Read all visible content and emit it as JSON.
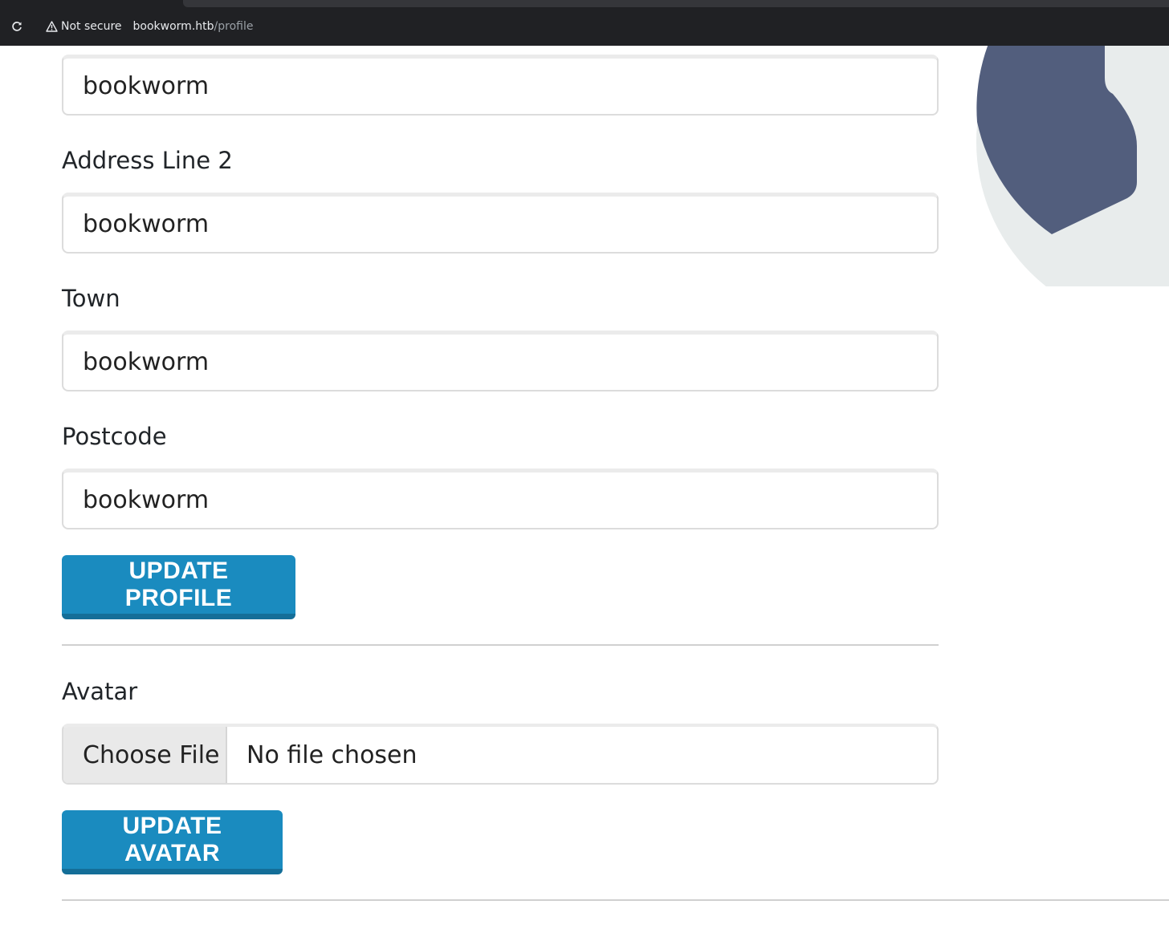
{
  "browser": {
    "not_secure_label": "Not secure",
    "url_host": "bookworm.htb",
    "url_path": "/profile",
    "reload_icon": "reload-icon",
    "warning_icon": "warning-triangle-icon"
  },
  "form": {
    "address_line_1": {
      "value": "bookworm"
    },
    "address_line_2": {
      "label": "Address Line 2",
      "value": "bookworm"
    },
    "town": {
      "label": "Town",
      "value": "bookworm"
    },
    "postcode": {
      "label": "Postcode",
      "value": "bookworm"
    },
    "update_profile_label": "UPDATE PROFILE"
  },
  "avatar_section": {
    "label": "Avatar",
    "choose_file_label": "Choose File",
    "file_status": "No file chosen",
    "update_avatar_label": "UPDATE AVATAR"
  },
  "colors": {
    "primary_button": "#1a8bbf",
    "avatar_dark": "#525e7d",
    "avatar_light": "#e8ecec"
  }
}
